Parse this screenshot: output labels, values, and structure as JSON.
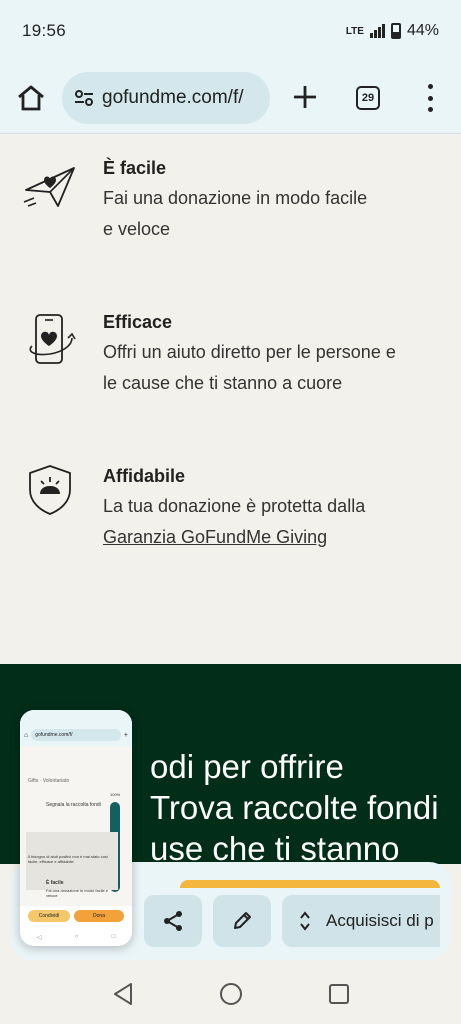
{
  "status_bar": {
    "time": "19:56",
    "network": "LTE",
    "battery": "44%"
  },
  "browser": {
    "url": "gofundme.com/f/",
    "tab_count": "29"
  },
  "features": [
    {
      "title": "È facile",
      "desc_lines": [
        "Fai una donazione in modo facile",
        "e veloce"
      ],
      "icon": "paper-plane-heart-icon"
    },
    {
      "title": "Efficace",
      "desc_lines": [
        "Offri un aiuto diretto per le persone e",
        "le cause che ti stanno a cuore"
      ],
      "icon": "phone-heart-icon"
    },
    {
      "title": "Affidabile",
      "desc_lines": [
        "La tua donazione è protetta dalla"
      ],
      "link": "Garanzia GoFundMe Giving",
      "icon": "shield-icon"
    }
  ],
  "green_section": {
    "heading_lines": [
      "odi per offrire",
      "Trova raccolte fondi",
      "use che ti stanno"
    ]
  },
  "actions": {
    "share": "share-icon",
    "edit": "pencil-icon",
    "capture_label": "Acquisisci di p"
  },
  "thumbnail": {
    "url": "gofundme.com/f/",
    "breadcrumb": "Gifts · Volontariato",
    "report": "Segnala la raccolta fondi",
    "card_text": "Il bisogno di aiuti positivi non è mai stato così facile, efficace e affidabile",
    "feature_title": "È facile",
    "feature_desc": "Fai una donazione in modo facile e veloce",
    "share_btn": "Condividi",
    "donate_btn": "Dona",
    "percent": "100%"
  },
  "colors": {
    "accent_green": "#012d19",
    "toolbar_bg": "#eaf5f8",
    "page_bg": "#f3f1ec",
    "orange": "#f4b63d",
    "teal": "#14605e"
  }
}
